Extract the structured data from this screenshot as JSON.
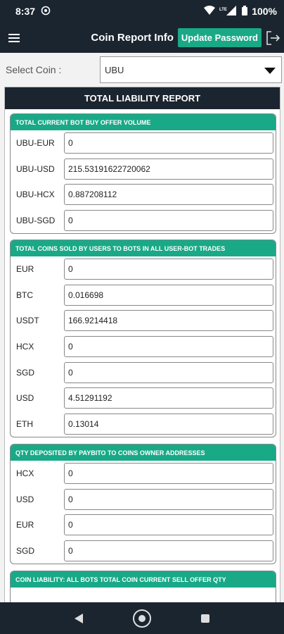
{
  "status_bar": {
    "time": "8:37",
    "battery": "100%",
    "network": "LTE"
  },
  "app_bar": {
    "title": "Coin Report Info",
    "update_password_label": "Update Password"
  },
  "coin_select": {
    "label": "Select Coin :",
    "value": "UBU"
  },
  "report": {
    "title": "TOTAL LIABILITY REPORT",
    "sections": [
      {
        "title": "TOTAL CURRENT BOT BUY OFFER VOLUME",
        "rows": [
          {
            "label": "UBU-EUR",
            "value": "0"
          },
          {
            "label": "UBU-USD",
            "value": "215.53191622720062"
          },
          {
            "label": "UBU-HCX",
            "value": "0.887208112"
          },
          {
            "label": "UBU-SGD",
            "value": "0"
          }
        ]
      },
      {
        "title": "TOTAL COINS SOLD BY USERS TO BOTS IN ALL USER-BOT TRADES",
        "rows": [
          {
            "label": "EUR",
            "value": "0"
          },
          {
            "label": "BTC",
            "value": "0.016698"
          },
          {
            "label": "USDT",
            "value": "166.9214418"
          },
          {
            "label": "HCX",
            "value": "0"
          },
          {
            "label": "SGD",
            "value": "0"
          },
          {
            "label": "USD",
            "value": "4.51291192"
          },
          {
            "label": "ETH",
            "value": "0.13014"
          }
        ]
      },
      {
        "title": "QTY DEPOSITED BY PAYBITO TO COINS OWNER ADDRESSES",
        "rows": [
          {
            "label": "HCX",
            "value": "0"
          },
          {
            "label": "USD",
            "value": "0"
          },
          {
            "label": "EUR",
            "value": "0"
          },
          {
            "label": "SGD",
            "value": "0"
          }
        ]
      },
      {
        "title": "COIN LIABILITY: ALL BOTS TOTAL COIN CURRENT SELL OFFER QTY",
        "rows": []
      }
    ]
  }
}
